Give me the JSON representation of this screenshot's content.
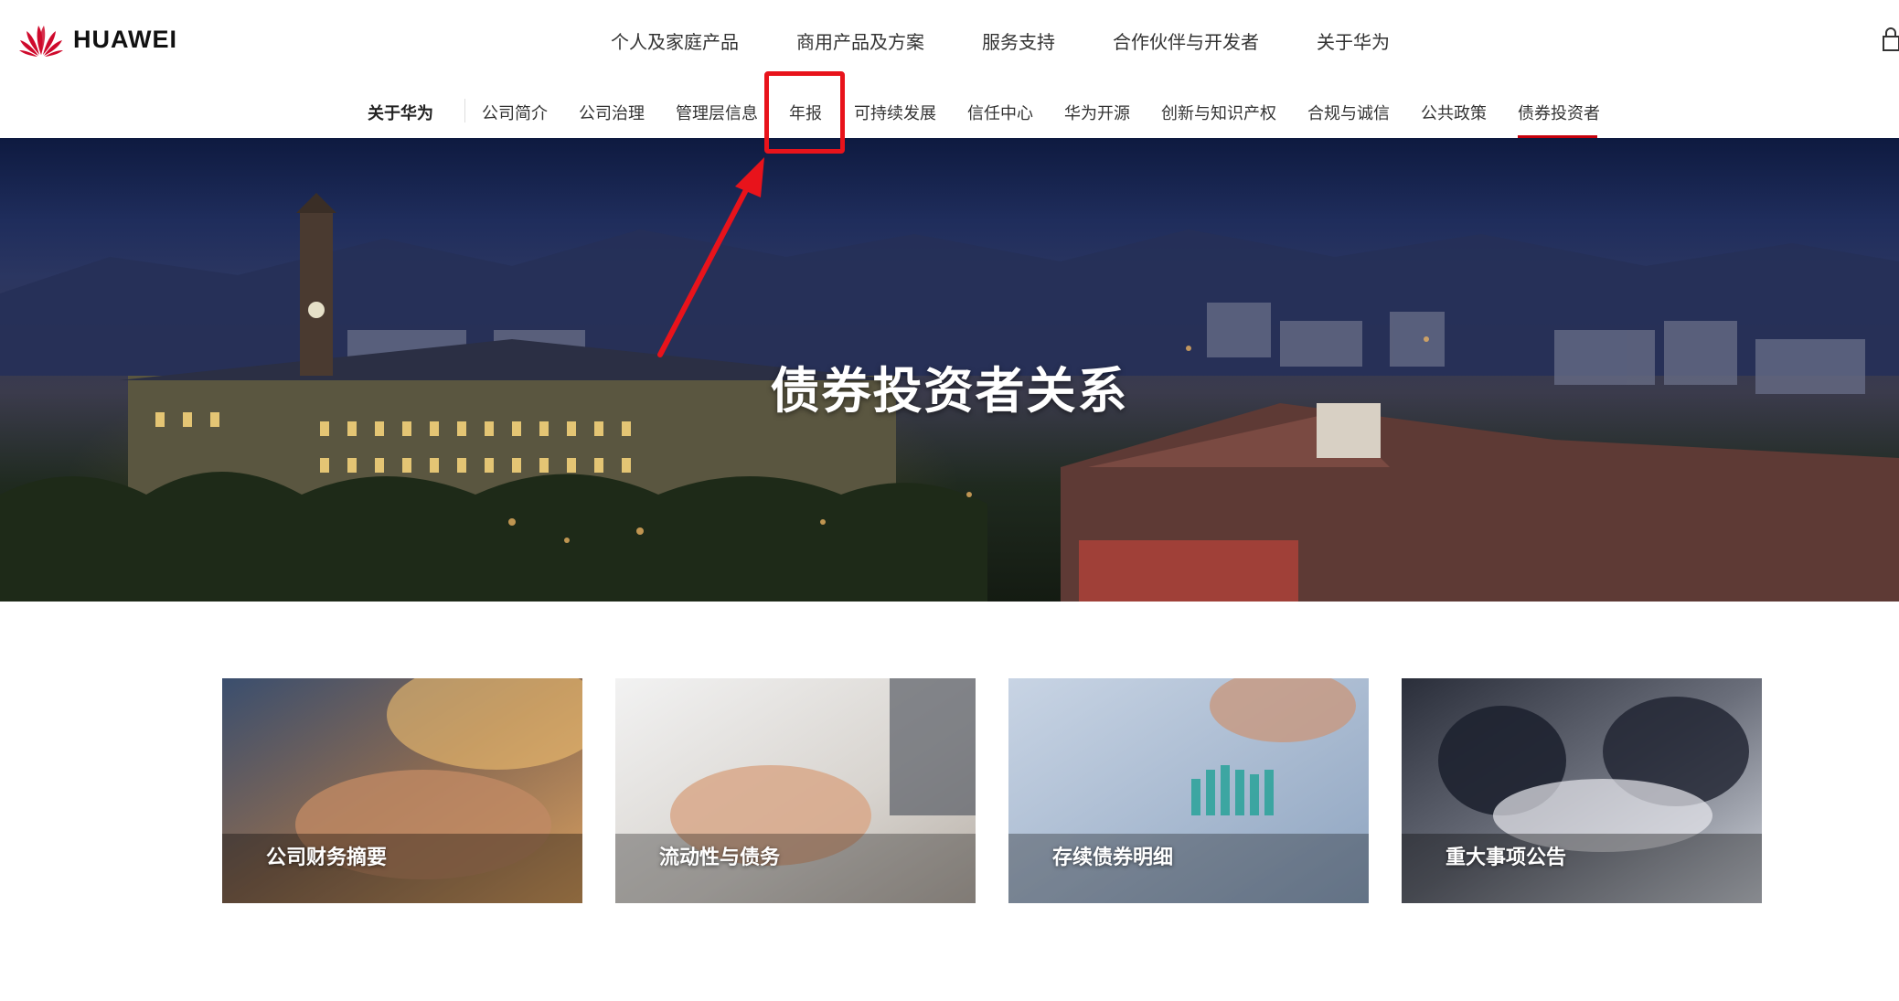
{
  "header": {
    "brand": "HUAWEI",
    "nav": [
      "个人及家庭产品",
      "商用产品及方案",
      "服务支持",
      "合作伙伴与开发者",
      "关于华为"
    ]
  },
  "subnav": {
    "section": "关于华为",
    "items": [
      "公司简介",
      "公司治理",
      "管理层信息",
      "年报",
      "可持续发展",
      "信任中心",
      "华为开源",
      "创新与知识产权",
      "合规与诚信",
      "公共政策",
      "债券投资者"
    ],
    "active": "债券投资者",
    "highlighted": "年报"
  },
  "hero": {
    "title": "债券投资者关系"
  },
  "cards": [
    {
      "label": "公司财务摘要"
    },
    {
      "label": "流动性与债务"
    },
    {
      "label": "存续债券明细"
    },
    {
      "label": "重大事项公告"
    }
  ],
  "colors": {
    "brand_red": "#c7000b",
    "annotation_red": "#e8131b"
  }
}
